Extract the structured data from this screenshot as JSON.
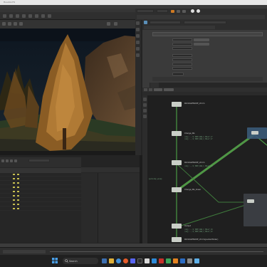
{
  "window": {
    "title": "Houdini FX"
  },
  "taskbar": {
    "search_placeholder": "Search"
  },
  "colors": {
    "node_color": "#c9cec7",
    "wire_color": "#4a9a45",
    "wire_highlight": "#5fa94f",
    "selected_node": "#5a8fb8",
    "network_bg": "#1f1f1f",
    "taskbar_bg": "#202020"
  },
  "network": {
    "nodes": [
      {
        "id": "n1",
        "label": "PACKAGENODE_xform",
        "note": ""
      },
      {
        "id": "n2",
        "label": "Charge_NG",
        "note": "/obj/.../S_TREE_RAW_C_HOLLY_17\n/obj/.../S_TREE_RAW_C_HOLLY_17\n/obj/.../S_TREE_RAW_C_HOLLY_27"
      },
      {
        "id": "n3",
        "label": "PACKAGENODE_xform",
        "note": ""
      },
      {
        "id": "n4",
        "label": "Charge_NG_linear",
        "note": "/obj/.../S_TREE_RAW_C_MEDIU..."
      },
      {
        "id": "n5",
        "label": "packcomp_wsnap",
        "note": ""
      },
      {
        "id": "n6",
        "label": "Output",
        "note": "/obj/.../S_TREE_RAW_C_HOLLY\n/obj/.../S_TREE_RAW_C_HOLLY_19\n/obj/.../S_TREE_RAW_C_HOLLY_22"
      },
      {
        "id": "n7",
        "label": "PACKAGENODE_xform(packedfolder)",
        "note": ""
      }
    ]
  }
}
